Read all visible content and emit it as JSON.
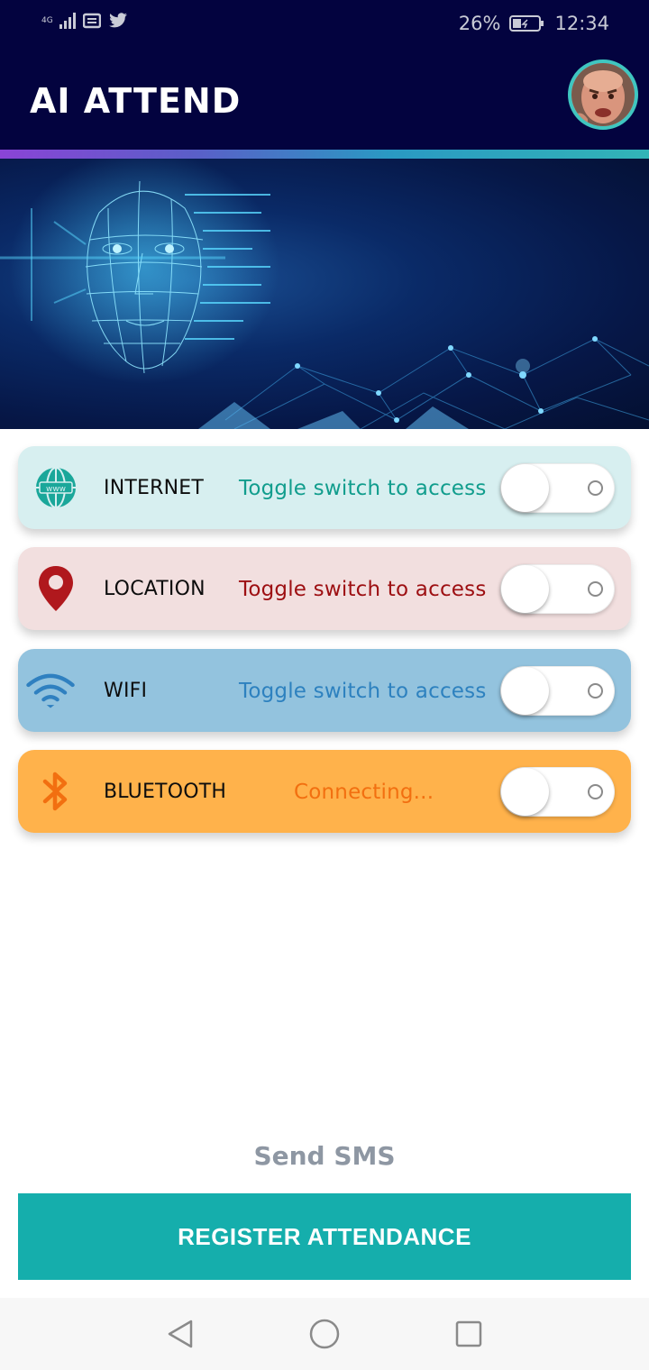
{
  "status_bar": {
    "network_type": "4G",
    "battery_percent": "26%",
    "time": "12:34",
    "notification_icons": [
      "signal-icon",
      "message-icon",
      "twitter-icon"
    ]
  },
  "app": {
    "title": "AI ATTEND",
    "avatar_icon": "user-avatar"
  },
  "colors": {
    "header": "#03033f",
    "accent": "#15aeac",
    "internet_card": "#d7eff0",
    "location_card": "#f2dfdf",
    "wifi_card": "#93c3de",
    "bluetooth_card": "#ffb24b"
  },
  "permissions": [
    {
      "label": "INTERNET",
      "status": "Toggle switch to access",
      "status_color": "#119d8d",
      "icon": "globe-www-icon",
      "enabled": false
    },
    {
      "label": "LOCATION",
      "status": "Toggle switch to access",
      "status_color": "#9d0f12",
      "icon": "location-pin-icon",
      "enabled": false
    },
    {
      "label": "WIFI",
      "status": "Toggle switch to access",
      "status_color": "#2d81bf",
      "icon": "wifi-icon",
      "enabled": false
    },
    {
      "label": "BLUETOOTH",
      "status": "Connecting...",
      "status_color": "#f26f10",
      "icon": "bluetooth-icon",
      "enabled": false
    }
  ],
  "actions": {
    "send_sms": "Send SMS",
    "register": "REGISTER ATTENDANCE"
  },
  "nav": [
    "back-icon",
    "home-icon",
    "recents-icon"
  ]
}
